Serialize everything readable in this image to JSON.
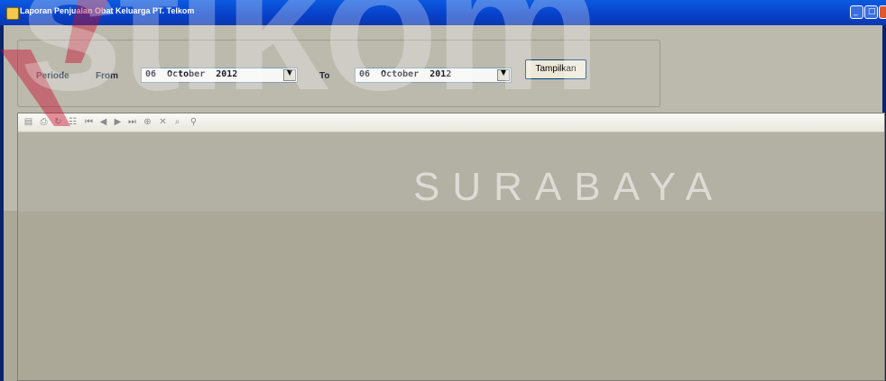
{
  "window": {
    "title": "Laporan Penjualan Obat Keluarga PT. Telkom",
    "controls": [
      "minimize-icon",
      "maximize-icon",
      "close-icon"
    ]
  },
  "filter": {
    "periode_label": "Periode",
    "from_label": "From",
    "from_value": "06  October  2012",
    "to_label": "To",
    "to_value": "06  October  2012",
    "button_label": "Tampilkan"
  },
  "report_toolbar": {
    "icons": [
      "export-icon",
      "print-icon",
      "refresh-icon",
      "group-tree-icon",
      "first-page-icon",
      "previous-page-icon",
      "next-page-icon",
      "last-page-icon",
      "goto-page-icon",
      "close-icon",
      "search-icon",
      "zoom-icon"
    ]
  },
  "watermark": {
    "main": "stikom",
    "sub": "SURABAYA"
  },
  "colors": {
    "titlebar": "#0a46d0",
    "client": "#bcb9ad",
    "watermark_red": "#c8102e"
  }
}
